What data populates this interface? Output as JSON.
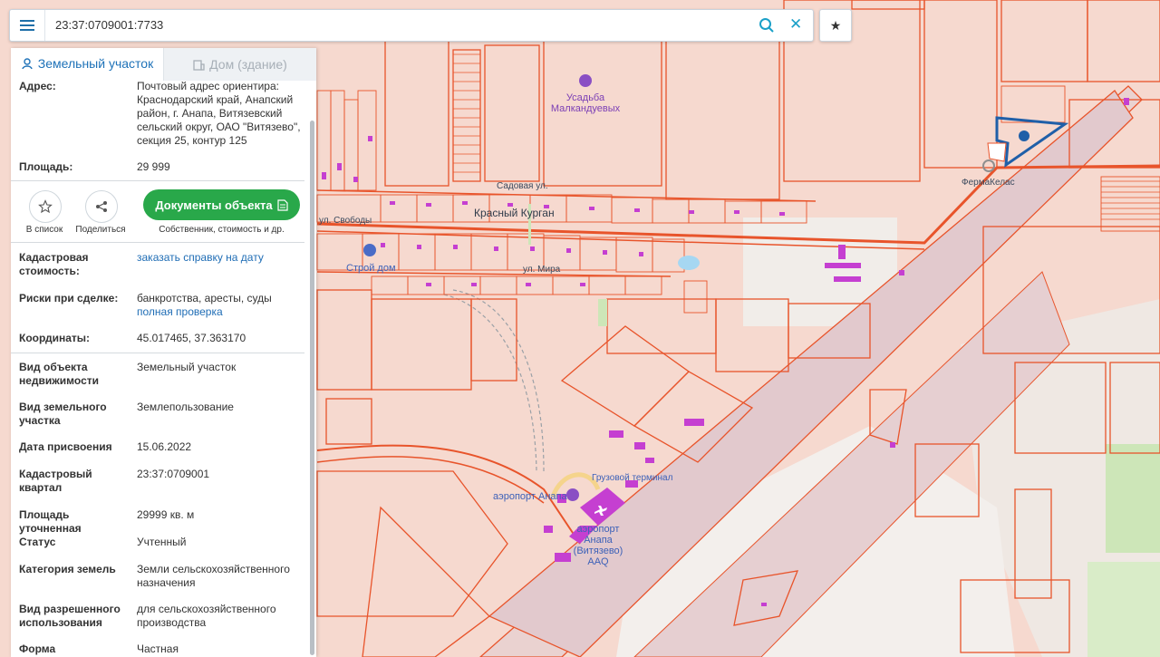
{
  "search": {
    "query": "23:37:0709001:7733"
  },
  "tabs": {
    "land": "Земельный участок",
    "house": "Дом (здание)"
  },
  "details": {
    "address_label": "Адрес:",
    "address_value": "Почтовый адрес ориентира: Краснодарский край, Анапский район, г. Анапа, Витязевский сельский округ, ОАО \"Витязево\", секция 25, контур 125",
    "area_label": "Площадь:",
    "area_value": "29 999",
    "cad_cost_label": "Кадастровая стоимость:",
    "cad_cost_link": "заказать справку на дату",
    "risks_label": "Риски при сделке:",
    "risks_value": "банкротства, аресты, суды",
    "risks_link": "полная проверка",
    "coords_label": "Координаты:",
    "coords_value": "45.017465, 37.363170",
    "object_type_label": "Вид объекта недвижимости",
    "object_type_value": "Земельный участок",
    "plot_type_label": "Вид земельного участка",
    "plot_type_value": "Землепользование",
    "date_label": "Дата присвоения",
    "date_value": "15.06.2022",
    "quarter_label": "Кадастровый квартал",
    "quarter_value": "23:37:0709001",
    "area_precise_label": "Площадь уточненная",
    "area_precise_value": "29999 кв. м",
    "status_label": "Статус",
    "status_value": "Учтенный",
    "category_label": "Категория земель",
    "category_value": "Земли сельскохозяйственного назначения",
    "permitted_label": "Вид разрешенного использования",
    "permitted_value": "для сельскохозяйственного производства",
    "form_label": "Форма",
    "form_value": "Частная"
  },
  "actions": {
    "to_list": "В список",
    "share": "Поделиться",
    "documents": "Документы объекта",
    "documents_sub": "Собственник, стоимость и др."
  },
  "map_labels": {
    "estate": "Усадьба\nМалкандуевых",
    "farm": "ФермаКелас",
    "village": "Красный Курган",
    "sadovaya": "Садовая ул.",
    "mira": "ул. Мира",
    "stroy": "Строй дом",
    "cargo": "Грузовой терминал",
    "airport_small": "аэропорт Анапа",
    "airport": "аэропорт\nАнапа\n(Витязево)\nAAQ",
    "svobody": "ул. Свободы"
  },
  "colors": {
    "accent": "#1e72b8",
    "parcel_line": "#e8542b",
    "selected": "#1f5fa8",
    "button_green": "#29a84a"
  },
  "icons": [
    "menu-icon",
    "search-icon",
    "close-icon",
    "star-icon",
    "user-pin-icon",
    "building-icon",
    "share-icon",
    "document-icon",
    "plane-icon"
  ]
}
